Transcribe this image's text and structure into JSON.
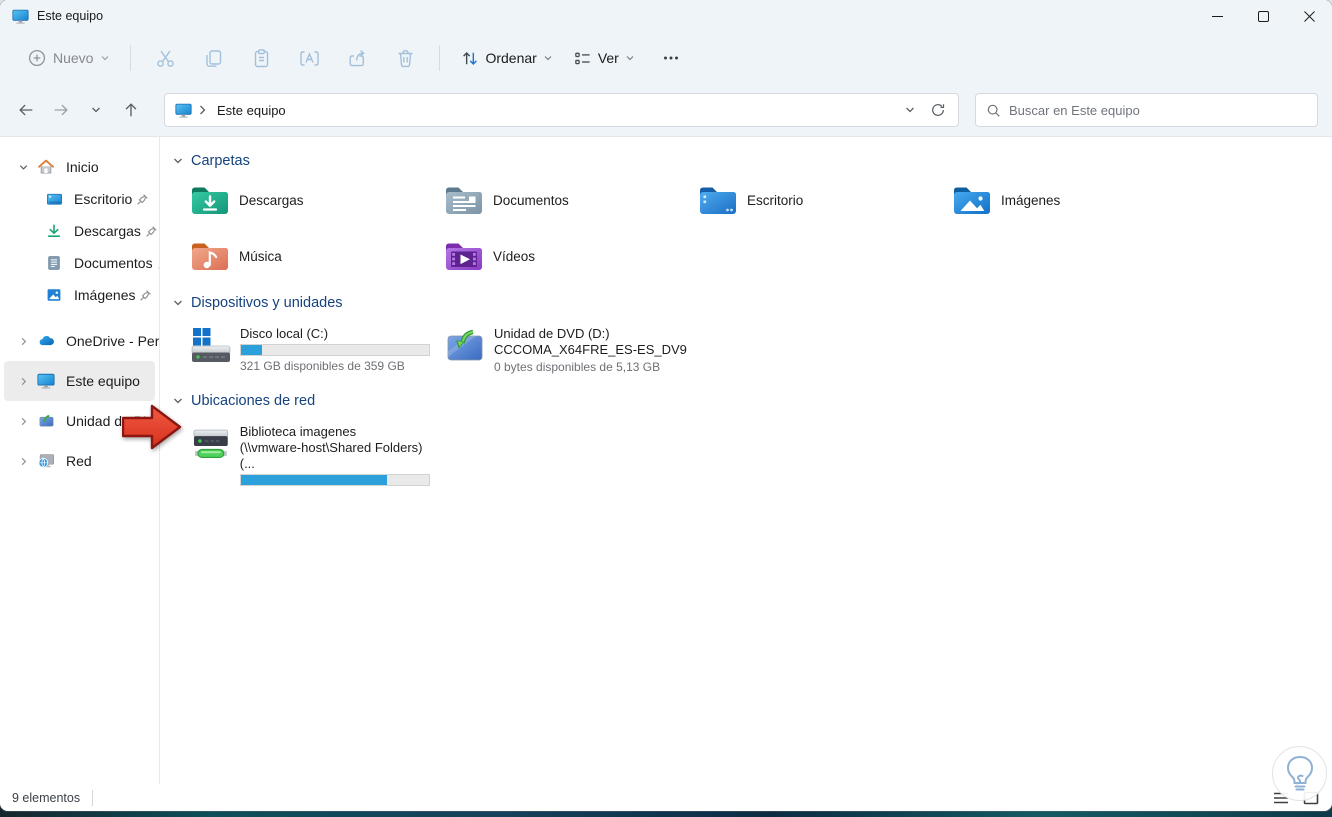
{
  "titlebar": {
    "title": "Este equipo"
  },
  "toolbar": {
    "new_label": "Nuevo",
    "sort_label": "Ordenar",
    "view_label": "Ver"
  },
  "navbar": {
    "breadcrumb": "Este equipo",
    "search_placeholder": "Buscar en Este equipo"
  },
  "sidebar": {
    "home": {
      "label": "Inicio"
    },
    "pinned": [
      {
        "label": "Escritorio"
      },
      {
        "label": "Descargas"
      },
      {
        "label": "Documentos"
      },
      {
        "label": "Imágenes"
      }
    ],
    "tree": [
      {
        "label": "OneDrive - Personal"
      },
      {
        "label": "Este equipo"
      },
      {
        "label": "Unidad de DVD (D:)"
      },
      {
        "label": "Red"
      }
    ]
  },
  "content": {
    "folders": {
      "title": "Carpetas",
      "items": [
        {
          "label": "Descargas"
        },
        {
          "label": "Documentos"
        },
        {
          "label": "Escritorio"
        },
        {
          "label": "Imágenes"
        },
        {
          "label": "Música"
        },
        {
          "label": "Vídeos"
        }
      ]
    },
    "devices": {
      "title": "Dispositivos y unidades",
      "disk": {
        "name": "Disco local (C:)",
        "details": "321 GB disponibles de 359 GB",
        "usage_percent": 11
      },
      "dvd": {
        "name": "Unidad de DVD (D:)",
        "subtitle": "CCCOMA_X64FRE_ES-ES_DV9",
        "details": "0 bytes disponibles de 5,13 GB"
      }
    },
    "network": {
      "title": "Ubicaciones de red",
      "share": {
        "name": "Biblioteca imagenes",
        "subtitle": "(\\\\vmware-host\\Shared Folders) (...",
        "usage_percent": 78
      }
    }
  },
  "statusbar": {
    "count": "9 elementos"
  },
  "colors": {
    "accent": "#2ba0da",
    "section_header": "#16427e",
    "arrow_fill": "#e8432e"
  }
}
